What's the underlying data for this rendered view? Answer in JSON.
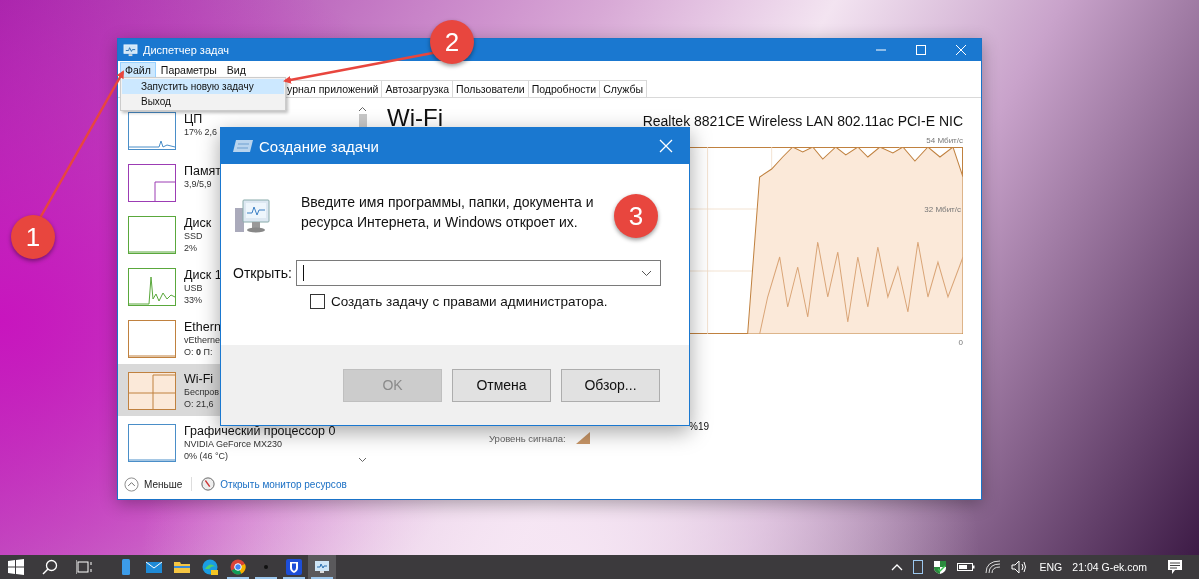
{
  "task_manager": {
    "title": "Диспетчер задач",
    "menu": [
      {
        "label": "Файл",
        "selected": true
      },
      {
        "label": "Параметры",
        "selected": false
      },
      {
        "label": "Вид",
        "selected": false
      }
    ],
    "file_menu": [
      {
        "label": "Запустить новую задачу",
        "selected": true
      },
      {
        "label": "Выход",
        "selected": false
      }
    ],
    "tabs": [
      "урнал приложений",
      "Автозагрузка",
      "Пользователи",
      "Подробности",
      "Службы"
    ],
    "sidebar": [
      {
        "name": "ЦП",
        "lines": [
          "17% 2,6"
        ],
        "color": "#4a8ec8",
        "selected": false
      },
      {
        "name": "Памят",
        "lines": [
          "3,9/5,9"
        ],
        "color": "#9c3cb4",
        "selected": false
      },
      {
        "name": "Диск",
        "lines": [
          "SSD",
          "2%"
        ],
        "color": "#5aa83c",
        "selected": false
      },
      {
        "name": "Диск 1",
        "lines": [
          "USB",
          "33%"
        ],
        "color": "#5aa83c",
        "selected": false
      },
      {
        "name": "Ethern",
        "lines": [
          "vEtherne",
          "О: **0** П:"
        ],
        "color": "#c0813f",
        "selected": false
      },
      {
        "name": "Wi-Fi",
        "lines": [
          "Беспров",
          "О: 21,6"
        ],
        "color": "#c0813f",
        "selected": true
      },
      {
        "name": "Графический процессор 0",
        "lines": [
          "NVIDIA GeForce MX230",
          "0% (46 °C)"
        ],
        "color": "#4a8ec8",
        "selected": false
      }
    ],
    "detail": {
      "title": "Wi-Fi",
      "adapter": "Realtek 8821CE Wireless LAN 802.11ac PCI-E NIC",
      "max_label": "54 Мбит/с",
      "mid_label": "32 Мбит/с",
      "min_label": "0",
      "signal_value": "%19",
      "signal_label": "Уровень сигнала:"
    },
    "footer": {
      "less": "Меньше",
      "monitor_link": "Открыть монитор ресурсов"
    }
  },
  "dialog": {
    "title": "Создание задачи",
    "message_lines": [
      "Введите имя программы, папки, документа и",
      "ресурса Интернета, и Windows откроет их."
    ],
    "open_label": "Открыть:",
    "admin_checkbox": {
      "label": "Создать задачу с правами администратора.",
      "checked": false
    },
    "buttons": [
      {
        "label": "OK",
        "disabled": true
      },
      {
        "label": "Отмена",
        "disabled": false
      },
      {
        "label": "Обзор...",
        "disabled": false
      }
    ]
  },
  "annotations": [
    {
      "label": "1"
    },
    {
      "label": "2"
    },
    {
      "label": "3"
    }
  ],
  "taskbar": {
    "apps": [
      {
        "kind": "phone",
        "running": false,
        "active": false
      },
      {
        "kind": "mail",
        "running": false,
        "active": false
      },
      {
        "kind": "folder",
        "running": false,
        "active": false
      },
      {
        "kind": "edge",
        "running": false,
        "active": false
      },
      {
        "kind": "chrome",
        "running": true,
        "active": false
      },
      {
        "kind": "dot",
        "running": true,
        "active": false
      },
      {
        "kind": "shield",
        "running": true,
        "active": false
      },
      {
        "kind": "monitor",
        "running": true,
        "active": true
      }
    ],
    "language": "ENG",
    "clock": "21:04 G-ek.com"
  }
}
